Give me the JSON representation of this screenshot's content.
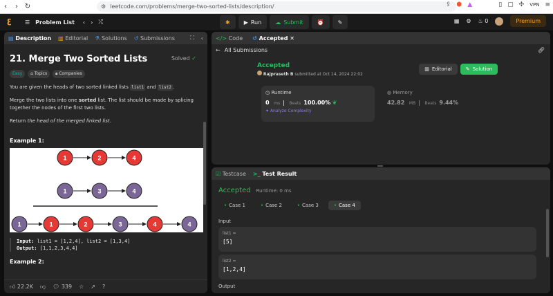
{
  "browser": {
    "url": "leetcode.com/problems/merge-two-sorted-lists/description/",
    "vpn": "VPN"
  },
  "topbar": {
    "problem_list": "Problem List",
    "run": "Run",
    "submit": "Submit",
    "streak": "0",
    "premium": "Premium"
  },
  "left": {
    "tabs": [
      "Description",
      "Editorial",
      "Solutions",
      "Submissions"
    ],
    "title": "21. Merge Two Sorted Lists",
    "status": "Solved",
    "tags": [
      "Easy",
      "Topics",
      "Companies"
    ],
    "para1_a": "You are given the heads of two sorted linked lists ",
    "para1_c1": "list1",
    "para1_and": " and ",
    "para1_c2": "list2",
    "para1_end": ".",
    "para2_a": "Merge the two lists into one ",
    "para2_b": "sorted",
    "para2_c": " list. The list should be made by splicing together the nodes of the first two lists.",
    "para3_a": "Return ",
    "para3_b": "the head of the merged linked list",
    "para3_c": ".",
    "example1": "Example 1:",
    "input_label": "Input:",
    "input_value": "list1 = [1,2,4], list2 = [1,3,4]",
    "output_label": "Output:",
    "output_value": "[1,1,2,3,4,4]",
    "example2": "Example 2:",
    "footer": {
      "likes": "22.2K",
      "comments": "339"
    },
    "diagram": {
      "row1": [
        "1",
        "2",
        "4"
      ],
      "row2": [
        "1",
        "3",
        "4"
      ],
      "row3": [
        "1",
        "1",
        "2",
        "3",
        "4",
        "4"
      ]
    }
  },
  "rtop": {
    "tabs": [
      "Code",
      "Accepted"
    ],
    "back": "All Submissions",
    "accepted": "Accepted",
    "submitter": "Rajpraseth B",
    "submitted_text": "submitted at Oct 14, 2024 22:02",
    "editorial_btn": "Editorial",
    "solution_btn": "Solution",
    "runtime_label": "Runtime",
    "runtime_value": "0",
    "runtime_unit": "ms",
    "beats_label": "Beats",
    "runtime_beats": "100.00%",
    "analyze": "Analyze Complexity",
    "memory_label": "Memory",
    "memory_value": "42.82",
    "memory_unit": "MB",
    "memory_beats": "9.44%"
  },
  "rbot": {
    "tabs": [
      "Testcase",
      "Test Result"
    ],
    "accepted": "Accepted",
    "runtime": "Runtime: 0 ms",
    "cases": [
      "Case 1",
      "Case 2",
      "Case 3",
      "Case 4"
    ],
    "input_label": "Input",
    "list1_label": "list1 =",
    "list1_value": "[5]",
    "list2_label": "list2 =",
    "list2_value": "[1,2,4]",
    "output_label": "Output"
  },
  "colors": {
    "accent_green": "#2cbb5d",
    "brand_orange": "#ffa116",
    "node_red": "#e53935",
    "node_purple": "#7b6796"
  }
}
